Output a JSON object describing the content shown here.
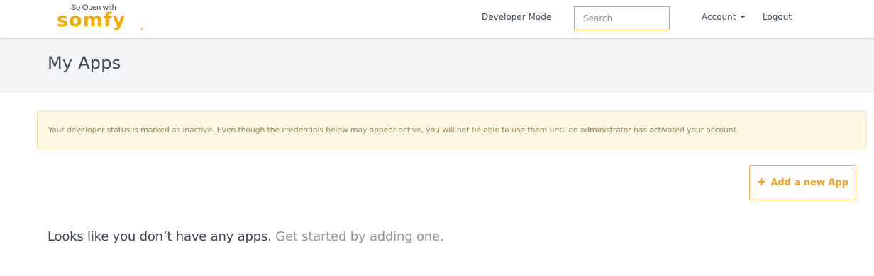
{
  "header": {
    "logo_tagline": "So Open with",
    "logo_word": "somfy",
    "logo_registered": "®",
    "nav": {
      "developer_mode": "Developer Mode",
      "account": "Account",
      "logout": "Logout"
    },
    "search": {
      "placeholder": "Search",
      "value": ""
    }
  },
  "page": {
    "title": "My Apps"
  },
  "alert": {
    "message": "Your developer status is marked as inactive. Even though the credentials below may appear active, you will not be able to use them until an administrator has activated your account."
  },
  "actions": {
    "add_app_icon": "+",
    "add_app_label": "Add a new App"
  },
  "empty_state": {
    "main": "Looks like you don’t have any apps.",
    "sub": "Get started by adding one."
  },
  "colors": {
    "brand": "#f2a900",
    "accent": "#f2a31b",
    "alert_bg": "#fcf8e3",
    "alert_text": "#98825a",
    "heading": "#3b4656"
  },
  "icons": {
    "account_caret": "caret-down-icon",
    "add_icon": "plus-icon"
  }
}
